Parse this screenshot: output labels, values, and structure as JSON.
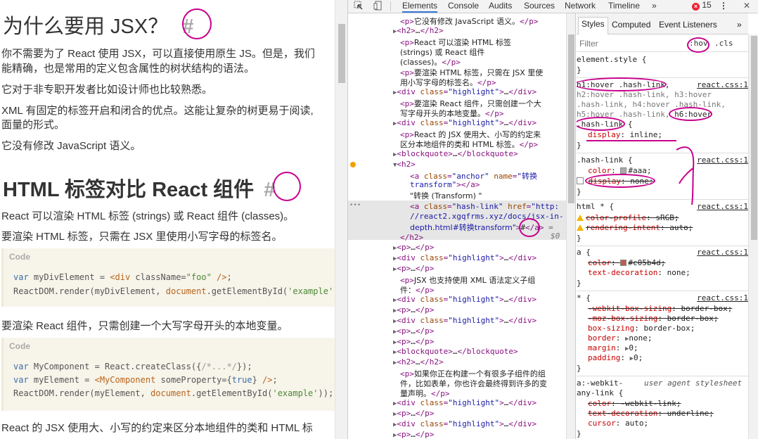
{
  "page": {
    "h_why": "为什么要用 JSX？",
    "hash": "#",
    "p_why1": "你不需要为了 React 使用 JSX，可以直接使用原生 JS。但是，我们",
    "p_why2": "能精确，也是常用的定义包含属性的树状结构的语法。",
    "p_why3": "它对于非专职开发者比如设计师也比较熟悉。",
    "p_why4": "XML 有固定的标签开启和闭合的优点。这能让复杂的树更易于阅读,",
    "p_why5": "面量的形式。",
    "p_why6": "它没有修改 JavaScript 语义。",
    "h_html": "HTML 标签对比 React 组件",
    "p_html1": "React 可以渲染 HTML 标签 (strings) 或 React 组件 (classes)。",
    "p_html2": "要渲染 HTML 标签，只需在 JSX 里使用小写字母的标签名。",
    "code_label": "Code",
    "code1_l1": "var myDivElement = <div className=\"foo\" />;",
    "code1_l2": "ReactDOM.render(myDivElement, document.getElementById('example')",
    "p_comp": "要渲染 React 组件，只需创建一个大写字母开头的本地变量。",
    "code2_l1": "var MyComponent = React.createClass({/*...*/});",
    "code2_l2": "var myElement = <MyComponent someProperty={true} />;",
    "code2_l3": "ReactDOM.render(myElement, document.getElementById('example'));",
    "p_last": "React 的 JSX 使用大、小写的约定来区分本地组件的类和 HTML 标"
  },
  "devtools": {
    "tabs": [
      "Elements",
      "Console",
      "Audits",
      "Sources",
      "Network",
      "Timeline"
    ],
    "more": "»",
    "error_count": "15",
    "menu": "⋮",
    "close": "✕",
    "styles_tabs": [
      "Styles",
      "Computed",
      "Event Listeners"
    ],
    "styles_more": "»",
    "filter_placeholder": "Filter",
    "hov": ":hov",
    "cls": ".cls",
    "accent": "#3879d9",
    "annotation_color": "#c8008c"
  },
  "elements": {
    "l1": "它没有修改 JavaScript 语义。",
    "l4": "React 可以渲染 HTML 标签",
    "l5": "(strings) 或 React 组件",
    "l6": "(classes)。",
    "l7": "要渲染 HTML 标签，只需在 JSX 里使",
    "l8": "用小写字母的标签名。",
    "l10": "要渲染 React 组件，只需创建一个大",
    "l11": "写字母开头的本地变量。",
    "l13": "React 的 JSX 使用大、小写的约定来",
    "l14": "区分本地组件的类和 HTML 标签。",
    "anchor_name": "转换",
    "anchor_name2": "transform",
    "text_node": "\"转换 (Transform) \"",
    "href1": "\"http:",
    "href2": "//react2.xgqfrms.xyz/docs/jsx-in-",
    "href3": "depth.html#转换transform\"",
    "hash_text": "#",
    "sel_eq": "=",
    "sel_id": "$0",
    "l_jsx1": "JSX 也支持使用 XML 语法定义子组",
    "l_jsx2": "件：",
    "l_build1": "如果你正在构建一个有很多子组件的组",
    "l_build2": "件，比如表单，你也许会最终得到许多的变",
    "l_build3": "量声明。",
    "ellipsis": "…",
    "cls_highlight": "\"highlight\"",
    "cls_anchor": "\"anchor\"",
    "cls_hashlink": "\"hash-link\""
  },
  "styles": {
    "element_style": "element.style {",
    "close": "}",
    "hover_sel1": "h1:hover .hash-link,",
    "hover_sel2": "h2:hover .hash-link, h3:hover",
    "hover_sel3": ".hash-link, h4:hover .hash-link,",
    "hover_sel4a": "h5:hover .hash-link,",
    "hover_sel4b": "h6:hover",
    "hover_sel5": ".hash-link",
    "open": " {",
    "display_prop": "display",
    "display_val": "inline;",
    "src_react": "react.css:1",
    "hashlink_sel": ".hash-link {",
    "color_prop": "color",
    "color_val": "#aaa;",
    "color_swatch": "#aaaaaa",
    "display_none": "none;",
    "html_sel": "html * {",
    "color_profile": "color-profile",
    "color_profile_val": "sRGB;",
    "rendering_intent": "rendering-intent",
    "rendering_intent_val": "auto;",
    "a_sel": "a {",
    "a_color_val": "#c05b4d;",
    "a_color_swatch": "#c05b4d",
    "text_decoration": "text-decoration",
    "text_decoration_val": "none;",
    "star_sel": "* {",
    "webkit_box": "-webkit-box-sizing",
    "moz_box": "-moz-box-sizing",
    "box_sizing": "box-sizing",
    "box_val": "border-box;",
    "border": "border",
    "border_val": "none;",
    "margin": "margin",
    "margin_val": "0;",
    "padding": "padding",
    "padding_val": "0;",
    "ua_sel1": "a:-webkit-",
    "ua_sel2": "any-link {",
    "ua_label": "user agent stylesheet",
    "ua_color_val": "-webkit-link;",
    "ua_td_val": "underline;",
    "cursor": "cursor",
    "cursor_val": "auto;"
  }
}
